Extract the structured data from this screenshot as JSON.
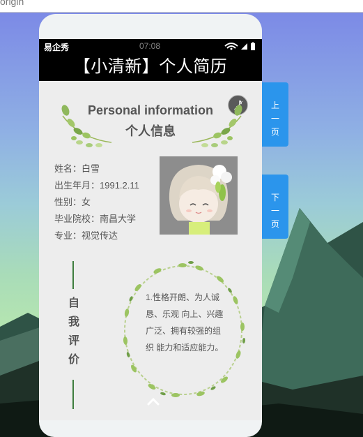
{
  "browser": {
    "address_fragment": "origin"
  },
  "phone": {
    "carrier": "易企秀",
    "time": "07:08",
    "title": "【小清新】个人简历"
  },
  "section_info": {
    "title_en": "Personal information",
    "title_cn": "个人信息",
    "fields": [
      {
        "text": "姓名：白雪"
      },
      {
        "text": "出生年月：1991.2.11"
      },
      {
        "text": "性别：女"
      },
      {
        "text": "毕业院校：南昌大学"
      },
      {
        "text": "专业：视觉传达"
      }
    ]
  },
  "section_self": {
    "heading_chars": [
      "自",
      "我",
      "评",
      "价"
    ],
    "lines": [
      "1.性格开朗、为人诚",
      "恳、乐观 向上、兴趣",
      "广泛、拥有较强的组",
      "织 能力和适应能力。"
    ]
  },
  "nav": {
    "prev_chars": [
      "上",
      "一",
      "页"
    ],
    "next_chars": [
      "下",
      "一",
      "页"
    ]
  },
  "colors": {
    "accent": "#2b95ec",
    "titlebar": "#000000",
    "leaf": "#7cb342"
  }
}
